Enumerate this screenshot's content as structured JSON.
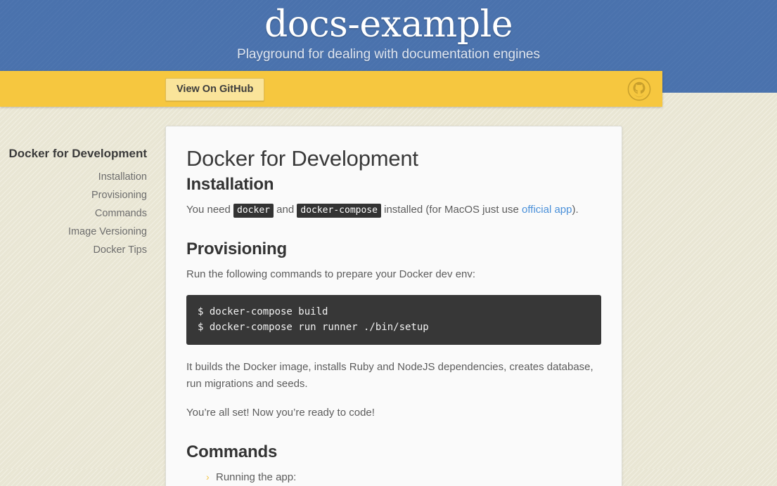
{
  "header": {
    "title": "docs-example",
    "tagline": "Playground for dealing with documentation engines",
    "background_color": "#4a72ad"
  },
  "action_bar": {
    "background_color": "#f6c73f",
    "github_button_label": "View On GitHub",
    "octocat_icon": "github-octocat-icon"
  },
  "sidebar": {
    "title": "Docker for Development",
    "items": [
      {
        "label": "Installation"
      },
      {
        "label": "Provisioning"
      },
      {
        "label": "Commands"
      },
      {
        "label": "Image Versioning"
      },
      {
        "label": "Docker Tips"
      }
    ]
  },
  "main": {
    "page_title": "Docker for Development",
    "installation": {
      "heading": "Installation",
      "text_before_code1": "You need ",
      "code1": "docker",
      "text_between_codes": " and ",
      "code2": "docker-compose",
      "text_after_code2": " installed (for MacOS just use ",
      "link_label": "official app",
      "text_tail": ")."
    },
    "provisioning": {
      "heading": "Provisioning",
      "intro": "Run the following commands to prepare your Docker dev env:",
      "code_block": "$ docker-compose build\n$ docker-compose run runner ./bin/setup",
      "paragraph1": "It builds the Docker image, installs Ruby and NodeJS dependencies, creates database, run migrations and seeds.",
      "paragraph2": "You’re all set! Now you’re ready to code!"
    },
    "commands": {
      "heading": "Commands",
      "items": [
        {
          "marker": "›",
          "label": "Running the app:"
        }
      ]
    }
  },
  "colors": {
    "page_background": "#e9e6d4",
    "card_background": "#fafafa",
    "link": "#4a90d9",
    "code_background": "#373737",
    "inline_code_background": "#333333",
    "list_marker": "#f3c74a"
  }
}
